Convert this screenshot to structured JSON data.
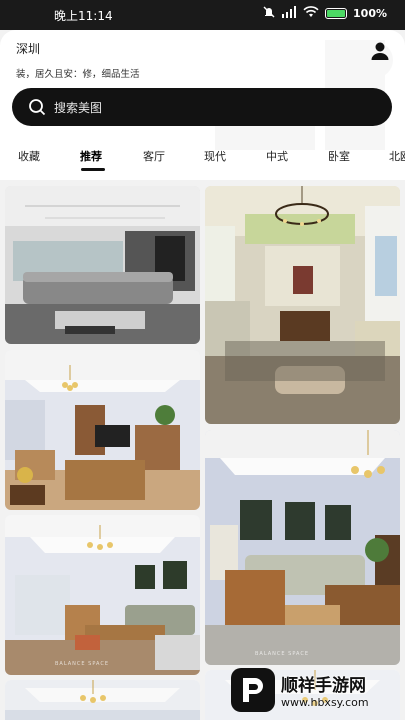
{
  "status_bar": {
    "time": "晚上11:14",
    "battery_pct": "100%"
  },
  "header": {
    "city": "深圳",
    "slogan": "装，居久且安：修，细品生活"
  },
  "search": {
    "placeholder": "搜索美图"
  },
  "tabs": [
    {
      "label": "收藏"
    },
    {
      "label": "推荐"
    },
    {
      "label": "客厅"
    },
    {
      "label": "现代"
    },
    {
      "label": "中式"
    },
    {
      "label": "卧室"
    },
    {
      "label": "北欧"
    }
  ],
  "active_tab": "推荐",
  "cards": {
    "watermark_text": "BALANCE SPACE"
  },
  "watermark": {
    "title": "顺祥手游网",
    "url": "www.hbxsy.com"
  },
  "icons": [
    "user-icon",
    "search-icon",
    "wifi-icon",
    "signal-icon",
    "battery-icon"
  ],
  "colors": {
    "search_bg": "#121212",
    "status_bg": "#1a1a1a"
  }
}
